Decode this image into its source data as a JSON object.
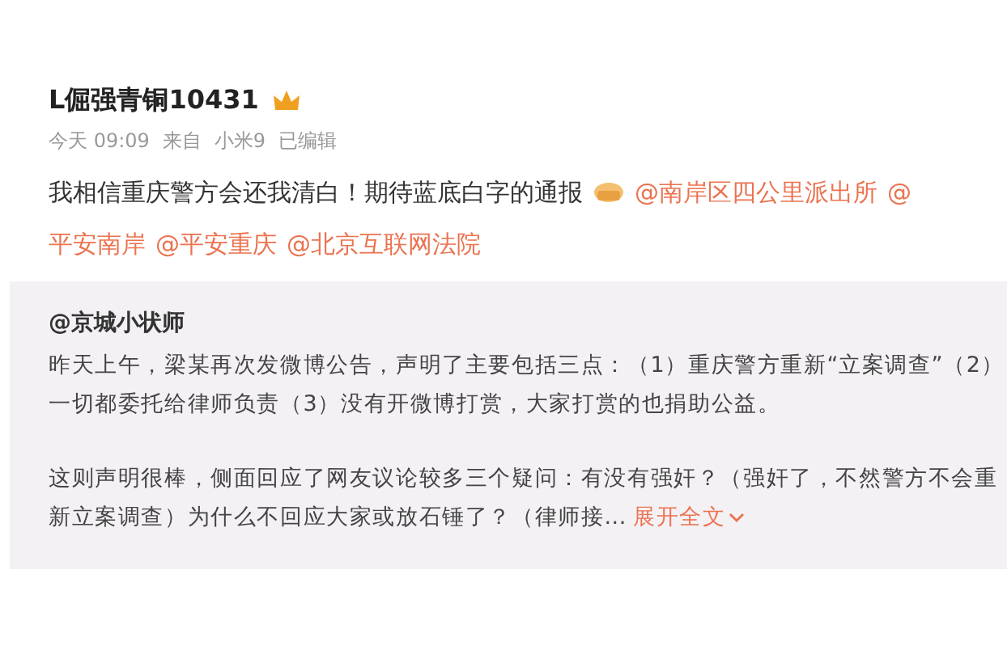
{
  "post": {
    "username": "L倔强青铜10431",
    "meta": [
      {
        "text": "今天 09:09"
      },
      {
        "text": "来自"
      },
      {
        "text": "小米9"
      },
      {
        "text": "已编辑"
      }
    ],
    "lines": [
      [
        {
          "kind": "text",
          "text": "我相信重庆警方会还我清白！期待蓝底白字的通报"
        },
        {
          "kind": "emoji"
        },
        {
          "kind": "mention",
          "text": "@南岸区四公里派出所"
        },
        {
          "kind": "mention",
          "text": "@"
        }
      ],
      [
        {
          "kind": "mention",
          "text": "平安南岸"
        },
        {
          "kind": "mention",
          "text": "@平安重庆"
        },
        {
          "kind": "mention",
          "text": "@北京互联网法院"
        }
      ]
    ]
  },
  "repost": {
    "author": "@京城小状师",
    "paragraphs": [
      [
        "昨天上午，梁某再次发微博公告，声明了主要包括三点：（1）重庆警方重新“立案调查”（2）",
        "一切都委托给律师负责（3）没有开微博打赏，大家打赏的也捐助公益。"
      ],
      [
        "这则声明很棒，侧面回应了网友议论较多三个疑问：有没有强奸？（强奸了，不然警方不会重",
        "新立案调查）为什么不回应大家或放石锤了？（律师接..."
      ]
    ],
    "expand": "展开全文"
  }
}
